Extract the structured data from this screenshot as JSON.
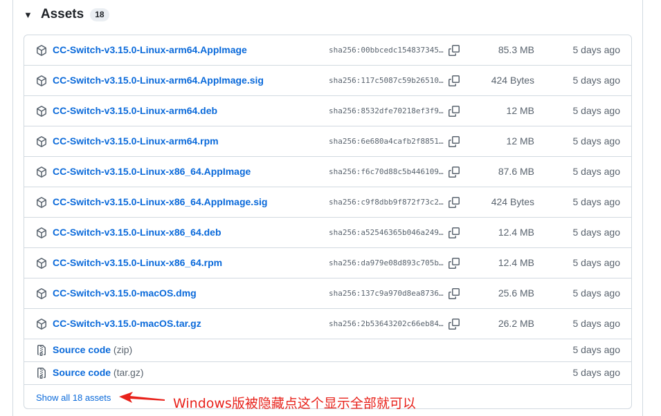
{
  "section": {
    "title": "Assets",
    "count": "18",
    "collapse_glyph": "▼"
  },
  "assets": [
    {
      "name": "CC-Switch-v3.15.0-Linux-arm64.AppImage",
      "sha": "sha256:00bbcedc154837345…",
      "size": "85.3 MB",
      "date": "5 days ago"
    },
    {
      "name": "CC-Switch-v3.15.0-Linux-arm64.AppImage.sig",
      "sha": "sha256:117c5087c59b26510…",
      "size": "424 Bytes",
      "date": "5 days ago"
    },
    {
      "name": "CC-Switch-v3.15.0-Linux-arm64.deb",
      "sha": "sha256:8532dfe70218ef3f9…",
      "size": "12 MB",
      "date": "5 days ago"
    },
    {
      "name": "CC-Switch-v3.15.0-Linux-arm64.rpm",
      "sha": "sha256:6e680a4cafb2f8851…",
      "size": "12 MB",
      "date": "5 days ago"
    },
    {
      "name": "CC-Switch-v3.15.0-Linux-x86_64.AppImage",
      "sha": "sha256:f6c70d88c5b446109…",
      "size": "87.6 MB",
      "date": "5 days ago"
    },
    {
      "name": "CC-Switch-v3.15.0-Linux-x86_64.AppImage.sig",
      "sha": "sha256:c9f8dbb9f872f73c2…",
      "size": "424 Bytes",
      "date": "5 days ago"
    },
    {
      "name": "CC-Switch-v3.15.0-Linux-x86_64.deb",
      "sha": "sha256:a52546365b046a249…",
      "size": "12.4 MB",
      "date": "5 days ago"
    },
    {
      "name": "CC-Switch-v3.15.0-Linux-x86_64.rpm",
      "sha": "sha256:da979e08d893c705b…",
      "size": "12.4 MB",
      "date": "5 days ago"
    },
    {
      "name": "CC-Switch-v3.15.0-macOS.dmg",
      "sha": "sha256:137c9a970d8ea8736…",
      "size": "25.6 MB",
      "date": "5 days ago"
    },
    {
      "name": "CC-Switch-v3.15.0-macOS.tar.gz",
      "sha": "sha256:2b53643202c66eb84…",
      "size": "26.2 MB",
      "date": "5 days ago"
    }
  ],
  "source_code": [
    {
      "label": "Source code",
      "format": "(zip)",
      "date": "5 days ago"
    },
    {
      "label": "Source code",
      "format": "(tar.gz)",
      "date": "5 days ago"
    }
  ],
  "show_all": "Show all 18 assets",
  "annotation": "Windows版被隐藏点这个显示全部就可以",
  "icons": {
    "asset": "package-icon",
    "copy": "copy-icon",
    "source": "file-zip-icon",
    "arrow": "red-arrow-annotation"
  },
  "colors": {
    "link": "#0969da",
    "muted": "#59636e",
    "border": "#d1d9e0",
    "annotation": "#e8221b"
  }
}
